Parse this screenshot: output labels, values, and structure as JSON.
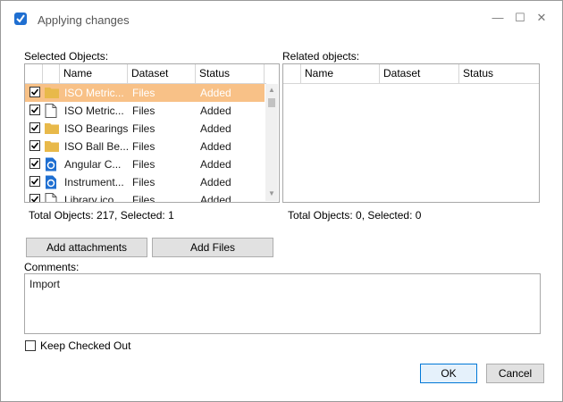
{
  "window": {
    "title": "Applying changes",
    "controls": [
      "—",
      "☐",
      "✕"
    ]
  },
  "selected": {
    "label": "Selected Objects:",
    "columns": [
      "Name",
      "Dataset",
      "Status"
    ],
    "rows": [
      {
        "name": "ISO Metric...",
        "dataset": "Files",
        "status": "Added",
        "icon": "folder-icon",
        "checked": true,
        "selected": true
      },
      {
        "name": "ISO Metric...",
        "dataset": "Files",
        "status": "Added",
        "icon": "document-icon",
        "checked": true,
        "selected": false
      },
      {
        "name": "ISO Bearings",
        "dataset": "Files",
        "status": "Added",
        "icon": "folder-icon",
        "checked": true,
        "selected": false
      },
      {
        "name": "ISO Ball Be...",
        "dataset": "Files",
        "status": "Added",
        "icon": "folder-icon",
        "checked": true,
        "selected": false
      },
      {
        "name": "Angular C...",
        "dataset": "Files",
        "status": "Added",
        "icon": "part-file-icon",
        "checked": true,
        "selected": false
      },
      {
        "name": "Instrument...",
        "dataset": "Files",
        "status": "Added",
        "icon": "part-file-icon",
        "checked": true,
        "selected": false
      },
      {
        "name": "Library ico...",
        "dataset": "Files",
        "status": "Added",
        "icon": "document-icon",
        "checked": true,
        "selected": false
      }
    ],
    "total": "Total Objects: 217, Selected: 1"
  },
  "related": {
    "label": "Related objects:",
    "columns": [
      "Name",
      "Dataset",
      "Status"
    ],
    "total": "Total Objects: 0, Selected: 0"
  },
  "buttons": {
    "add_attachments": "Add attachments",
    "add_files": "Add Files",
    "ok": "OK",
    "cancel": "Cancel"
  },
  "comments": {
    "label": "Comments:",
    "value": "Import"
  },
  "keep_checked_out": {
    "label": "Keep Checked Out",
    "checked": false
  },
  "colors": {
    "selection": "#f8c187",
    "folder": "#e8b94a",
    "part": "#1f6fd1"
  }
}
